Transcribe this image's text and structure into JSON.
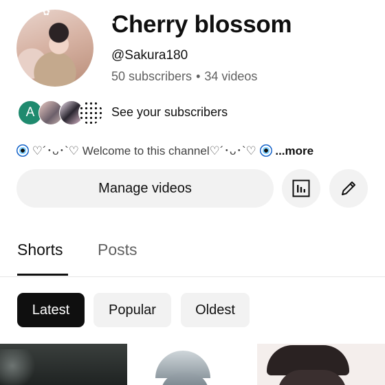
{
  "channel": {
    "name": "Cherry blossom",
    "handle": "@Sakura180",
    "subscribers": "50 subscribers",
    "separator": "•",
    "videos": "34 videos",
    "description_prefix": "♡´･ᴗ･`♡ Welcome to this channel♡´･ᴗ･`♡",
    "more_label": "...more"
  },
  "subscribers_row": {
    "first_initial": "A",
    "label": "See your subscribers"
  },
  "actions": {
    "manage_label": "Manage videos",
    "analytics_icon": "analytics-icon",
    "edit_icon": "pencil-icon"
  },
  "tabs": [
    {
      "label": "Shorts",
      "selected": true
    },
    {
      "label": "Posts",
      "selected": false
    }
  ],
  "filters": [
    {
      "label": "Latest",
      "selected": true
    },
    {
      "label": "Popular",
      "selected": false
    },
    {
      "label": "Oldest",
      "selected": false
    }
  ],
  "colors": {
    "chip_selected_bg": "#0f0f0f",
    "chip_bg": "#f2f2f2",
    "secondary_text": "#606060"
  }
}
